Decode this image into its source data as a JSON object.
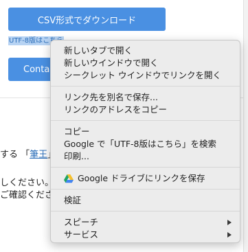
{
  "page": {
    "csv_button": "CSV形式でダウンロード",
    "utf8_link": "UTF-8版はこちら",
    "contact_button": "Contact",
    "line1_prefix": "する 「",
    "line1_link": "筆王",
    "line1_suffix": "」",
    "line2": "しください。",
    "line3": "ご確認くださ"
  },
  "menu": {
    "open_new_tab": "新しいタブで開く",
    "open_new_window": "新しいウインドウで開く",
    "open_incognito": "シークレット ウインドウでリンクを開く",
    "save_link_as": "リンク先を別名で保存...",
    "copy_link_address": "リンクのアドレスをコピー",
    "copy": "コピー",
    "search_google": "Google で「UTF-8版はこちら」を検索",
    "print": "印刷...",
    "save_to_drive": "Google ドライブにリンクを保存",
    "inspect": "検証",
    "speech": "スピーチ",
    "services": "サービス"
  },
  "colors": {
    "accent": "#4a90e2",
    "link": "#2a6db8",
    "menu_bg": "#ececec"
  },
  "icons": {
    "drive": "google-drive-icon",
    "submenu": "submenu-arrow-icon"
  }
}
